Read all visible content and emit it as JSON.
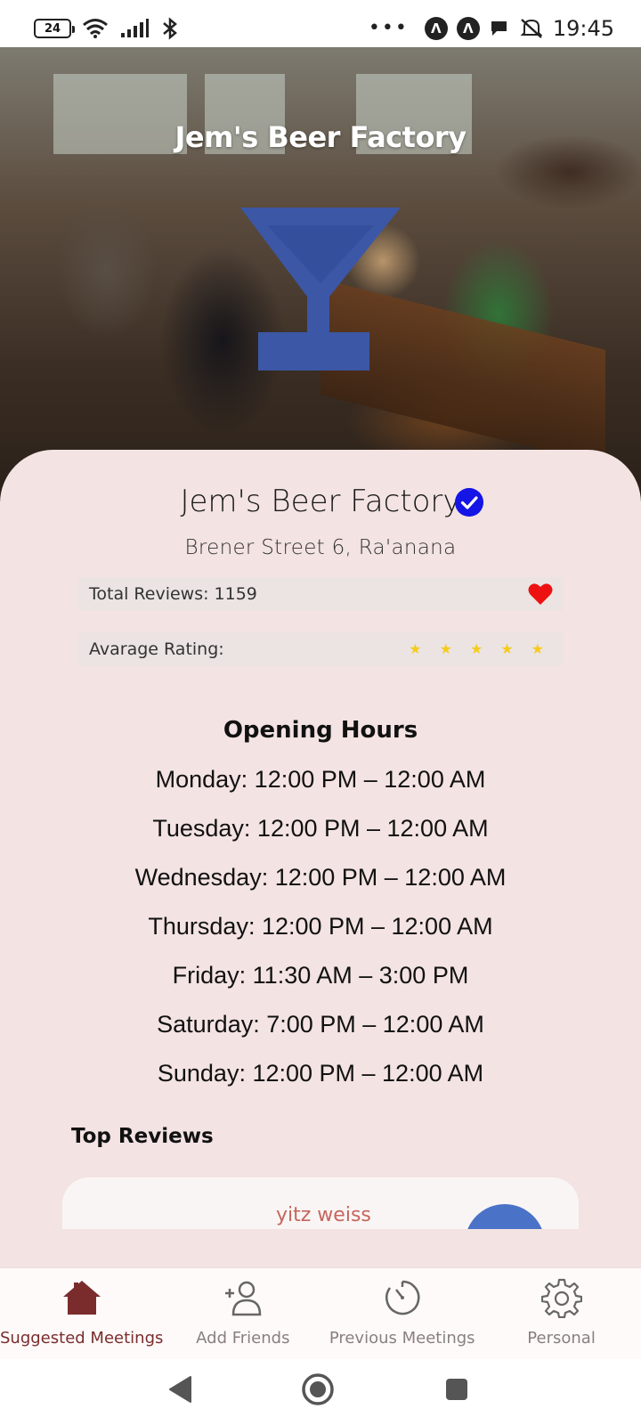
{
  "status_bar": {
    "battery": "24",
    "more": "•••",
    "time": "19:45"
  },
  "hero": {
    "title": "Jem's Beer Factory"
  },
  "place": {
    "name": "Jem's Beer Factory",
    "address": "Brener Street 6, Ra'anana",
    "total_reviews_label": "Total Reviews: 1159",
    "rating_label": "Avarage Rating:",
    "rating_stars_shown": 5,
    "accent_color": "#1515e6"
  },
  "opening_hours": {
    "title": "Opening Hours",
    "days": [
      "Monday: 12:00 PM – 12:00 AM",
      "Tuesday: 12:00 PM – 12:00 AM",
      "Wednesday: 12:00 PM – 12:00 AM",
      "Thursday: 12:00 PM – 12:00 AM",
      "Friday: 11:30 AM – 3:00 PM",
      "Saturday: 7:00 PM – 12:00 AM",
      "Sunday: 12:00 PM – 12:00 AM"
    ]
  },
  "reviews": {
    "title": "Top Reviews",
    "first_author": "yitz weiss"
  },
  "bottom_nav": {
    "items": [
      {
        "label": "Suggested Meetings",
        "icon": "home-icon",
        "active": true
      },
      {
        "label": "Add Friends",
        "icon": "add-person-icon",
        "active": false
      },
      {
        "label": "Previous Meetings",
        "icon": "timer-icon",
        "active": false
      },
      {
        "label": "Personal",
        "icon": "gear-icon",
        "active": false
      }
    ],
    "active_color": "#7a2c2c"
  }
}
